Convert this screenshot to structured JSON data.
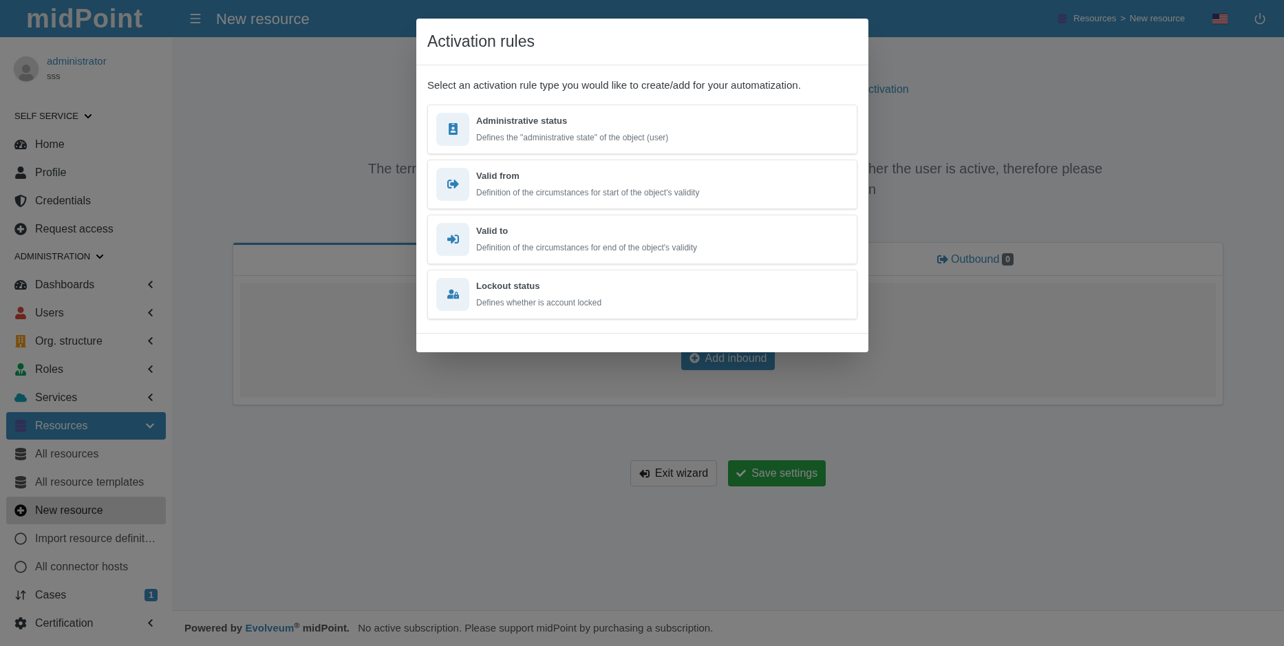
{
  "header": {
    "logo": "midPoint",
    "title": "New resource",
    "breadcrumbs": [
      {
        "label": "Resources"
      },
      {
        "label": ">"
      },
      {
        "label": "New resource"
      }
    ]
  },
  "sidebar": {
    "user": {
      "name": "administrator",
      "subtitle": "sss"
    },
    "sections": [
      {
        "title": "SELF SERVICE",
        "expanded": true,
        "items": [
          {
            "label": "Home",
            "selected": false
          },
          {
            "label": "Profile",
            "selected": false
          },
          {
            "label": "Credentials",
            "selected": false
          },
          {
            "label": "Request access",
            "selected": false
          }
        ]
      },
      {
        "title": "ADMINISTRATION",
        "expanded": true,
        "items": [
          {
            "label": "Dashboards",
            "selected": false,
            "expanded": false
          },
          {
            "label": "Users",
            "selected": false,
            "expanded": false
          },
          {
            "label": "Org. structure",
            "selected": false,
            "expanded": false
          },
          {
            "label": "Roles",
            "selected": false,
            "expanded": false
          },
          {
            "label": "Services",
            "selected": false,
            "expanded": false
          },
          {
            "label": "Resources",
            "selected": true,
            "expanded": true,
            "children": [
              {
                "label": "All resources",
                "selected": false
              },
              {
                "label": "All resource templates",
                "selected": false
              },
              {
                "label": "New resource",
                "selected": true
              },
              {
                "label": "Import resource definit…",
                "selected": false
              },
              {
                "label": "All connector hosts",
                "selected": false
              }
            ]
          },
          {
            "label": "Cases",
            "selected": false,
            "badge": "1"
          },
          {
            "label": "Certification",
            "selected": false,
            "expanded": false
          }
        ]
      }
    ]
  },
  "page": {
    "step_link": "ctivation",
    "description_left": "The terr",
    "description_right": [
      "her the user is active, therefore please",
      "n"
    ],
    "tabs": [
      {
        "label": "Outbound",
        "count": "0",
        "selected": false
      }
    ],
    "add_button": "Add inbound",
    "buttons": [
      {
        "label": "Exit wizard",
        "kind": "secondary"
      },
      {
        "label": "Save settings",
        "kind": "primary"
      }
    ]
  },
  "footer": {
    "lead": "Powered by",
    "link": "Evolveum",
    "tail": "$^{®}$ midPoint.",
    "notice": "No active subscription. Please support midPoint by purchasing a subscription."
  },
  "modal": {
    "title": "Activation rules",
    "intro": "Select an activation rule type you would like to create/add for your automatization.",
    "options": [
      {
        "title": "Administrative status",
        "description": "Defines the \"administrative state\" of the object (user)"
      },
      {
        "title": "Valid from",
        "description": "Definition of the circumstances for start of the object's validity"
      },
      {
        "title": "Valid to",
        "description": "Definition of the circumstances for end of the object's validity"
      },
      {
        "title": "Lockout status",
        "description": "Defines whether is account locked"
      }
    ]
  }
}
